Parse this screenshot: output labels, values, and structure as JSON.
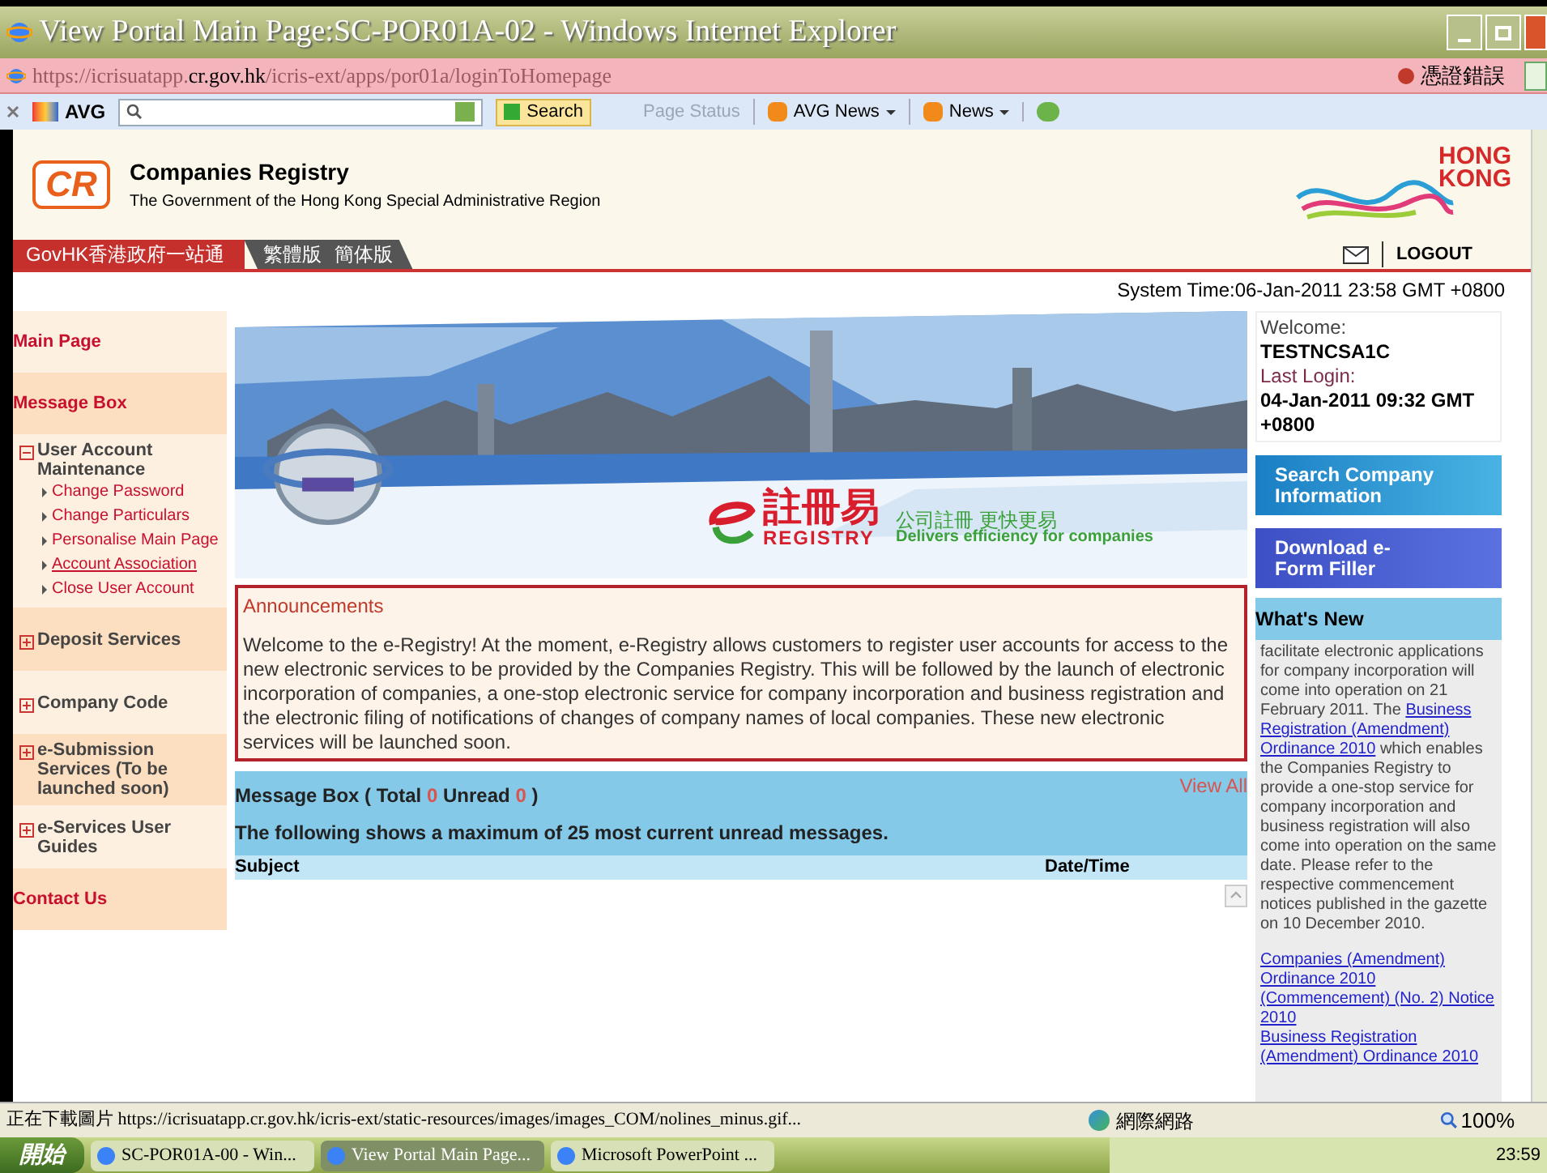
{
  "window": {
    "title": "View Portal Main Page:SC-POR01A-02 - Windows Internet Explorer"
  },
  "address_bar": {
    "url_prefix": "https://icrisuatapp.",
    "url_domain": "cr.gov.hk",
    "url_suffix": "/icris-ext/apps/por01a/loginToHomepage",
    "cert_error": "憑證錯誤"
  },
  "toolbar": {
    "brand": "AVG",
    "search_button": "Search",
    "page_status": "Page Status",
    "feeds": [
      "AVG News",
      "News"
    ]
  },
  "header": {
    "logo": "CR",
    "title": "Companies Registry",
    "subtitle": "The Government of the Hong Kong Special Administrative Region",
    "brand_lines": [
      "HONG",
      "KONG"
    ]
  },
  "nav": {
    "govhk": "GovHK香港政府一站通",
    "languages": [
      "繁體版",
      "簡体版"
    ],
    "logout": "LOGOUT"
  },
  "system_time": "System Time:06-Jan-2011 23:58 GMT +0800",
  "sidebar": {
    "items": [
      {
        "kind": "link",
        "label": "Main Page"
      },
      {
        "kind": "link",
        "label": "Message Box"
      },
      {
        "kind": "group",
        "label": "User Account Maintenance",
        "expanded": true,
        "children": [
          {
            "label": "Change Password",
            "selected": false
          },
          {
            "label": "Change Particulars",
            "selected": false
          },
          {
            "label": "Personalise Main Page",
            "selected": false
          },
          {
            "label": "Account Association",
            "selected": true
          },
          {
            "label": "Close User Account",
            "selected": false
          }
        ]
      },
      {
        "kind": "group",
        "label": "Deposit Services",
        "expanded": false
      },
      {
        "kind": "group",
        "label": "Company Code",
        "expanded": false
      },
      {
        "kind": "group",
        "label": "e-Submission Services (To be launched soon)",
        "expanded": false
      },
      {
        "kind": "group",
        "label": "e-Services User Guides",
        "expanded": false
      },
      {
        "kind": "link",
        "label": "Contact Us"
      }
    ]
  },
  "banner": {
    "chinese_name": "註冊易",
    "english_name": "REGISTRY",
    "slogan_cn": "公司註冊 更快更易",
    "slogan_en": "Delivers efficiency for companies"
  },
  "announcements": {
    "title": "Announcements",
    "body": "Welcome to the e-Registry! At the moment, e-Registry allows customers to register user accounts for access to the new electronic services to be provided by the Companies Registry. This will be followed by the launch of electronic incorporation of companies, a one-stop electronic service for company incorporation and business registration and the electronic filing of notifications of changes of company names of local companies. These new electronic services will be launched soon."
  },
  "message_box": {
    "title_start": "Message Box ( Total",
    "total": "0",
    "unread_label": "Unread",
    "unread": "0",
    "title_end": ")",
    "view_all": "View All",
    "subtitle": "The following shows a maximum of 25 most current unread messages.",
    "columns": [
      "Subject",
      "Date/Time"
    ]
  },
  "welcome": {
    "label": "Welcome:",
    "user": "TESTNCSA1C",
    "last_login_label": "Last Login:",
    "last_login": "04-Jan-2011 09:32 GMT +0800"
  },
  "quick_links": [
    "Search Company Information",
    "Download e-Form Filler"
  ],
  "whats_new": {
    "title": "What's New",
    "paragraph": [
      {
        "kind": "text",
        "text": "facilitate electronic applications for company incorporation will come into operation on 21 February 2011. The "
      },
      {
        "kind": "link",
        "text": "Business"
      },
      {
        "kind": "link",
        "text": "Registration (Amendment)"
      },
      {
        "kind": "link",
        "text": "Ordinance 2010"
      },
      {
        "kind": "text",
        "text": " which enables the Companies Registry to provide a one-stop service for company incorporation and business registration will also come into operation on the same date. Please refer to the respective commencement notices published in the gazette on 10 December 2010."
      }
    ],
    "links": [
      "Companies (Amendment) Ordinance 2010 (Commencement) (No. 2) Notice 2010",
      "Business Registration (Amendment) Ordinance 2010"
    ]
  },
  "status_bar": {
    "text": "正在下載圖片 https://icrisuatapp.cr.gov.hk/icris-ext/static-resources/images/images_COM/nolines_minus.gif...",
    "zone": "網際網路",
    "zoom": "100%"
  },
  "taskbar": {
    "start": "開始",
    "tasks": [
      {
        "label": "SC-POR01A-00 - Win...",
        "selected": false
      },
      {
        "label": "View Portal Main Page...",
        "selected": true
      },
      {
        "label": "Microsoft PowerPoint ...",
        "selected": false
      }
    ],
    "clock": "23:59"
  }
}
